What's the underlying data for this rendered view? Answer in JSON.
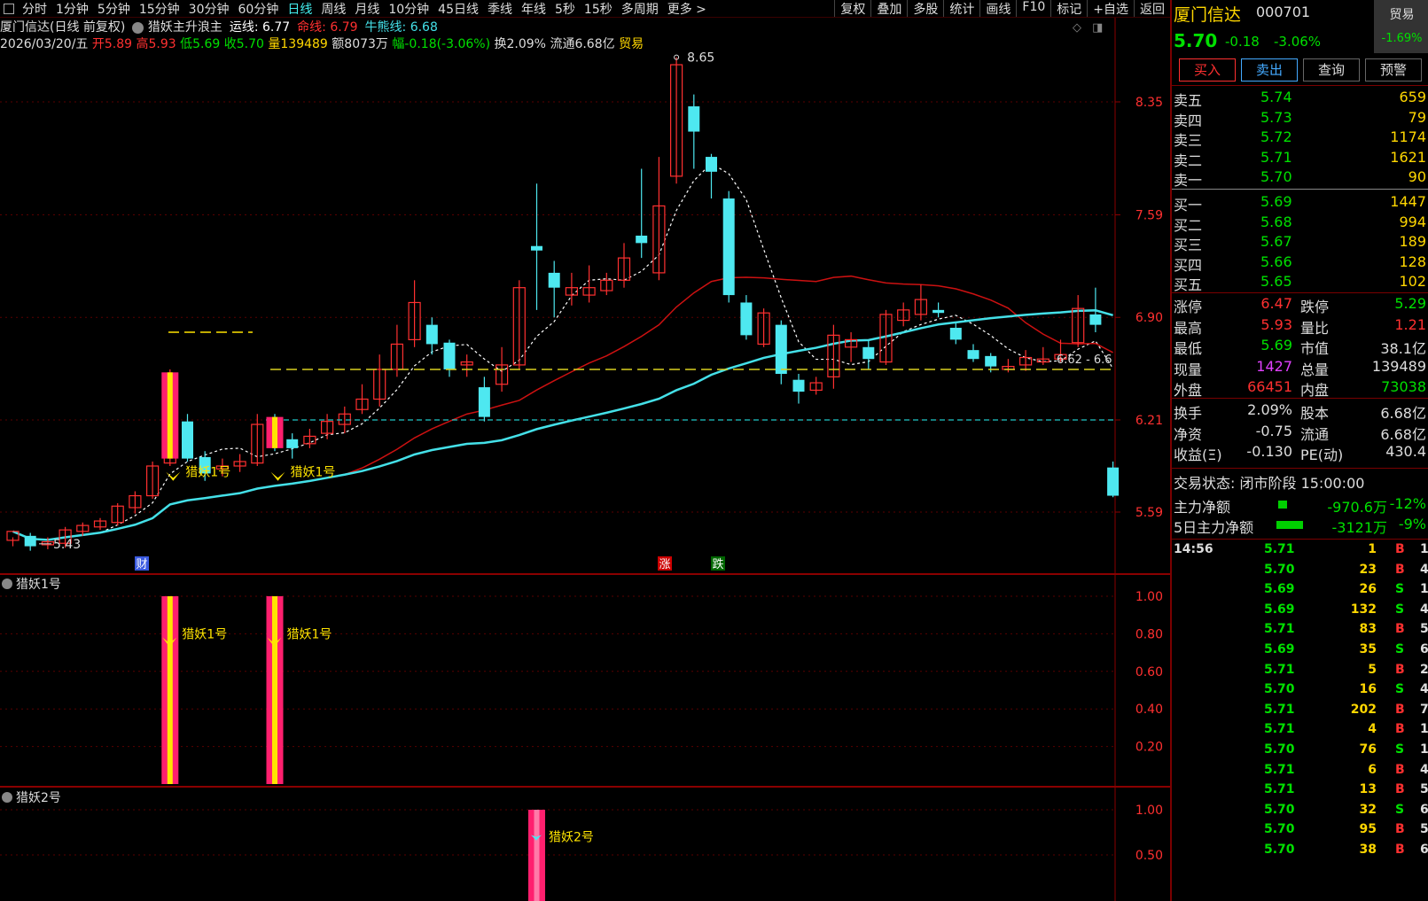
{
  "topbar": {
    "tabs": [
      "分时",
      "1分钟",
      "5分钟",
      "15分钟",
      "30分钟",
      "60分钟",
      "日线",
      "周线",
      "月线",
      "10分钟",
      "45日线",
      "季线",
      "年线",
      "5秒",
      "15秒",
      "多周期",
      "更多 >"
    ],
    "active_tab": "日线",
    "tools": [
      "复权",
      "叠加",
      "多股",
      "统计",
      "画线",
      "F10",
      "标记",
      "+自选",
      "返回"
    ]
  },
  "info1": {
    "title": "厦门信达(日线 前复权)",
    "indicator": "猎妖主升浪主",
    "yx_label": "运线:",
    "yx_val": "6.77",
    "mx_label": "命线:",
    "mx_val": "6.79",
    "nx_label": "牛熊线:",
    "nx_val": "6.68"
  },
  "info2": {
    "date": "2026/03/20/五",
    "open": "开5.89",
    "high": "高5.93",
    "low": "低5.69",
    "close": "收5.70",
    "vol": "量139489",
    "amt": "额8073万",
    "amp": "幅-0.18(-3.06%)",
    "turn": "换2.09%",
    "float": "流通6.68亿",
    "tag": "贸易"
  },
  "main_chart": {
    "yticks": [
      "8.35",
      "7.59",
      "6.90",
      "6.21",
      "5.59"
    ],
    "high_label": "8.65",
    "low_label": "5.43",
    "right_label": "6.62 - 6.6",
    "signal_label": "猎妖1号",
    "event_labels": [
      "财",
      "涨",
      "跌"
    ]
  },
  "candles": [
    [
      5.4,
      5.46,
      5.36,
      5.42
    ],
    [
      5.43,
      5.36,
      5.33,
      5.45
    ],
    [
      5.37,
      5.39,
      5.34,
      5.42
    ],
    [
      5.38,
      5.47,
      5.35,
      5.49
    ],
    [
      5.46,
      5.5,
      5.43,
      5.52
    ],
    [
      5.49,
      5.53,
      5.47,
      5.55
    ],
    [
      5.52,
      5.63,
      5.5,
      5.65
    ],
    [
      5.62,
      5.7,
      5.58,
      5.73
    ],
    [
      5.7,
      5.9,
      5.68,
      5.93
    ],
    [
      5.92,
      6.47,
      5.9,
      6.55
    ],
    [
      6.2,
      5.95,
      5.93,
      6.25
    ],
    [
      5.96,
      5.85,
      5.8,
      6.0
    ],
    [
      5.88,
      5.9,
      5.83,
      5.95
    ],
    [
      5.9,
      5.93,
      5.86,
      5.98
    ],
    [
      5.92,
      6.18,
      5.9,
      6.25
    ],
    [
      6.22,
      6.05,
      6.0,
      6.25
    ],
    [
      6.08,
      6.02,
      5.95,
      6.12
    ],
    [
      6.05,
      6.1,
      6.02,
      6.15
    ],
    [
      6.12,
      6.2,
      6.08,
      6.25
    ],
    [
      6.18,
      6.25,
      6.12,
      6.3
    ],
    [
      6.28,
      6.35,
      6.25,
      6.45
    ],
    [
      6.35,
      6.55,
      6.3,
      6.65
    ],
    [
      6.55,
      6.72,
      6.5,
      6.85
    ],
    [
      6.75,
      7.0,
      6.7,
      7.15
    ],
    [
      6.85,
      6.72,
      6.65,
      6.9
    ],
    [
      6.73,
      6.55,
      6.5,
      6.75
    ],
    [
      6.58,
      6.6,
      6.5,
      6.65
    ],
    [
      6.43,
      6.23,
      6.2,
      6.5
    ],
    [
      6.45,
      6.58,
      6.4,
      6.7
    ],
    [
      6.58,
      7.1,
      6.55,
      7.15
    ],
    [
      7.38,
      7.35,
      6.95,
      7.8
    ],
    [
      7.2,
      7.1,
      6.9,
      7.28
    ],
    [
      7.05,
      7.1,
      6.98,
      7.2
    ],
    [
      7.05,
      7.1,
      7.0,
      7.25
    ],
    [
      7.08,
      7.15,
      7.05,
      7.2
    ],
    [
      7.15,
      7.3,
      7.1,
      7.4
    ],
    [
      7.45,
      7.4,
      7.3,
      7.9
    ],
    [
      7.2,
      7.65,
      7.15,
      7.98
    ],
    [
      7.85,
      8.6,
      7.8,
      8.65
    ],
    [
      8.32,
      8.15,
      7.9,
      8.4
    ],
    [
      7.98,
      7.88,
      7.7,
      8.0
    ],
    [
      7.7,
      7.05,
      7.0,
      7.75
    ],
    [
      7.0,
      6.78,
      6.75,
      7.05
    ],
    [
      6.72,
      6.93,
      6.7,
      6.96
    ],
    [
      6.85,
      6.52,
      6.45,
      6.88
    ],
    [
      6.48,
      6.4,
      6.32,
      6.52
    ],
    [
      6.41,
      6.46,
      6.38,
      6.5
    ],
    [
      6.5,
      6.78,
      6.42,
      6.85
    ],
    [
      6.7,
      6.75,
      6.6,
      6.8
    ],
    [
      6.7,
      6.62,
      6.55,
      6.75
    ],
    [
      6.6,
      6.92,
      6.58,
      6.95
    ],
    [
      6.88,
      6.95,
      6.84,
      7.0
    ],
    [
      6.92,
      7.02,
      6.88,
      7.12
    ],
    [
      6.95,
      6.93,
      6.9,
      7.0
    ],
    [
      6.83,
      6.75,
      6.72,
      6.86
    ],
    [
      6.68,
      6.62,
      6.6,
      6.72
    ],
    [
      6.64,
      6.57,
      6.53,
      6.66
    ],
    [
      6.55,
      6.57,
      6.53,
      6.62
    ],
    [
      6.58,
      6.63,
      6.54,
      6.68
    ],
    [
      6.6,
      6.62,
      6.58,
      6.7
    ],
    [
      6.62,
      6.65,
      6.6,
      6.75
    ],
    [
      6.73,
      6.96,
      6.7,
      7.05
    ],
    [
      6.92,
      6.85,
      6.8,
      7.1
    ],
    [
      5.89,
      5.7,
      5.69,
      5.93
    ]
  ],
  "panel1": {
    "title": "猎妖1号",
    "yticks": [
      "1.00",
      "0.80",
      "0.60",
      "0.40",
      "0.20"
    ],
    "signal_label": "猎妖1号"
  },
  "panel2": {
    "title": "猎妖2号",
    "yticks": [
      "1.00",
      "0.50"
    ],
    "signal_label": "猎妖2号"
  },
  "stock": {
    "name": "厦门信达",
    "code": "000701",
    "price": "5.70",
    "chg": "-0.18",
    "pct": "-3.06%",
    "sector": "贸易",
    "sector_pct": "-1.69%"
  },
  "trade_buttons": {
    "buy": "买入",
    "sell": "卖出",
    "query": "查询",
    "alert": "预警"
  },
  "orderbook": {
    "asks": [
      {
        "label": "卖五",
        "price": "5.74",
        "vol": "659"
      },
      {
        "label": "卖四",
        "price": "5.73",
        "vol": "79"
      },
      {
        "label": "卖三",
        "price": "5.72",
        "vol": "1174"
      },
      {
        "label": "卖二",
        "price": "5.71",
        "vol": "1621"
      },
      {
        "label": "卖一",
        "price": "5.70",
        "vol": "90"
      }
    ],
    "bids": [
      {
        "label": "买一",
        "price": "5.69",
        "vol": "1447"
      },
      {
        "label": "买二",
        "price": "5.68",
        "vol": "994"
      },
      {
        "label": "买三",
        "price": "5.67",
        "vol": "189"
      },
      {
        "label": "买四",
        "price": "5.66",
        "vol": "128"
      },
      {
        "label": "买五",
        "price": "5.65",
        "vol": "102"
      }
    ]
  },
  "stats": {
    "limit_up_l": "涨停",
    "limit_up": "6.47",
    "limit_dn_l": "跌停",
    "limit_dn": "5.29",
    "high_l": "最高",
    "high": "5.93",
    "vol_ratio_l": "量比",
    "vol_ratio": "1.21",
    "low_l": "最低",
    "low": "5.69",
    "mktcap_l": "市值",
    "mktcap": "38.1亿",
    "cur_vol_l": "现量",
    "cur_vol": "1427",
    "tot_vol_l": "总量",
    "tot_vol": "139489",
    "outer_l": "外盘",
    "outer": "66451",
    "inner_l": "内盘",
    "inner": "73038",
    "turn_l": "换手",
    "turn": "2.09%",
    "equity_l": "股本",
    "equity": "6.68亿",
    "nav_l": "净资",
    "nav": "-0.75",
    "float_l": "流通",
    "float": "6.68亿",
    "eps_l": "收益(Ξ)",
    "eps": "-0.130",
    "pe_l": "PE(动)",
    "pe": "430.4",
    "state": "交易状态: 闭市阶段 15:00:00",
    "main_net_l": "主力净额",
    "main_net": "-970.6万",
    "main_net_pct": "-12%",
    "main5_l": "5日主力净额",
    "main5": "-3121万",
    "main5_pct": "-9%"
  },
  "ticks": [
    {
      "t": "14:56",
      "p": "5.71",
      "v": "1",
      "d": "B",
      "n": "1"
    },
    {
      "t": "",
      "p": "5.70",
      "v": "23",
      "d": "B",
      "n": "4"
    },
    {
      "t": "",
      "p": "5.69",
      "v": "26",
      "d": "S",
      "n": "10"
    },
    {
      "t": "",
      "p": "5.69",
      "v": "132",
      "d": "S",
      "n": "43"
    },
    {
      "t": "",
      "p": "5.71",
      "v": "83",
      "d": "B",
      "n": "5"
    },
    {
      "t": "",
      "p": "5.69",
      "v": "35",
      "d": "S",
      "n": "6"
    },
    {
      "t": "",
      "p": "5.71",
      "v": "5",
      "d": "B",
      "n": "2"
    },
    {
      "t": "",
      "p": "5.70",
      "v": "16",
      "d": "S",
      "n": "4"
    },
    {
      "t": "",
      "p": "5.71",
      "v": "202",
      "d": "B",
      "n": "7"
    },
    {
      "t": "",
      "p": "5.71",
      "v": "4",
      "d": "B",
      "n": "1"
    },
    {
      "t": "",
      "p": "5.70",
      "v": "76",
      "d": "S",
      "n": "13"
    },
    {
      "t": "",
      "p": "5.71",
      "v": "6",
      "d": "B",
      "n": "4"
    },
    {
      "t": "",
      "p": "5.71",
      "v": "13",
      "d": "B",
      "n": "5"
    },
    {
      "t": "",
      "p": "5.70",
      "v": "32",
      "d": "S",
      "n": "6"
    },
    {
      "t": "",
      "p": "5.70",
      "v": "95",
      "d": "B",
      "n": "5"
    },
    {
      "t": "",
      "p": "5.70",
      "v": "38",
      "d": "B",
      "n": "6"
    }
  ],
  "colors": {
    "up": "#ff3030",
    "down": "#4ee8f0",
    "ma_white": "#ffffff",
    "ma_red": "#cc1111",
    "ma_cyan": "#44e0e8",
    "signal_pink": "#ff1f6e",
    "signal_yellow": "#ffe400"
  }
}
